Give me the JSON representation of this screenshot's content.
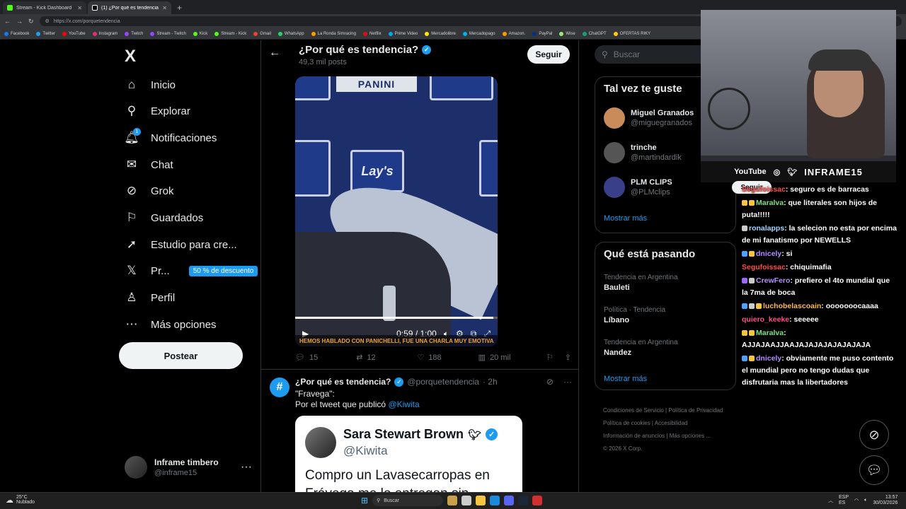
{
  "browser": {
    "tabs": [
      {
        "label": "Stream - Kick Dashboard",
        "color": "#53fc18"
      },
      {
        "label": "(1) ¿Por qué es tendencia? (@porq",
        "color": "#ffffff"
      }
    ],
    "url": "https://x.com/porquetendencia",
    "bookmarks": [
      "Facebook",
      "Twitter",
      "YouTube",
      "Instagram",
      "Twitch",
      "Stream - Twitch",
      "Kick",
      "Stream - Kick",
      "Gmail",
      "WhatsApp",
      "La Ronda Simracing",
      "Netflix",
      "Prime Video",
      "Mercadolibre",
      "Mercadopago",
      "Amazon.",
      "PayPal",
      "Wise",
      "ChatGPT",
      "OFERTAS RIKY"
    ]
  },
  "nav": {
    "logo": "X",
    "items": [
      {
        "label": "Inicio",
        "icon": "home-icon",
        "glyph": "⌂"
      },
      {
        "label": "Explorar",
        "icon": "search-icon",
        "glyph": "⚲"
      },
      {
        "label": "Notificaciones",
        "icon": "bell-icon",
        "glyph": "🔔︎",
        "badge": "1"
      },
      {
        "label": "Chat",
        "icon": "mail-icon",
        "glyph": "✉"
      },
      {
        "label": "Grok",
        "icon": "grok-icon",
        "glyph": "⊘"
      },
      {
        "label": "Guardados",
        "icon": "bookmark-icon",
        "glyph": "⚐"
      },
      {
        "label": "Estudio para cre...",
        "icon": "rocket-icon",
        "glyph": "➚"
      },
      {
        "label": "Pr...",
        "icon": "x-premium-icon",
        "glyph": "𝕏",
        "promo": "50 % de descuento"
      },
      {
        "label": "Perfil",
        "icon": "profile-icon",
        "glyph": "♙"
      },
      {
        "label": "Más opciones",
        "icon": "more-circle-icon",
        "glyph": "⋯"
      }
    ],
    "post_label": "Postear",
    "account": {
      "name": "Inframe timbero",
      "handle": "@inframe15"
    }
  },
  "profile": {
    "title": "¿Por qué es tendencia?",
    "posts": "49,3 mil posts",
    "follow_label": "Seguir"
  },
  "tweet1": {
    "video": {
      "panel_top": "PANINI",
      "panel_logo": "Lay's",
      "caption": "HEMOS HABLADO CON PANICHELLI, FUE UNA CHARLA MUY EMOTIVA",
      "time": "0:59 / 1:00",
      "progress": 0.98
    },
    "replies": "15",
    "reposts": "12",
    "likes": "188",
    "views": "20 mil"
  },
  "tweet2": {
    "avatar": "#",
    "name": "¿Por qué es tendencia?",
    "handle": "@porquetendencia",
    "time": "· 2h",
    "line1": "\"Fravega\":",
    "line2_prefix": "Por el tweet que publicó",
    "mention": "@Kiwita",
    "card": {
      "name": "Sara Stewart Brown",
      "handle": "@Kiwita",
      "text": "Compro un Lavasecarropas en Frávega me lo entregan sin..."
    }
  },
  "right": {
    "search_placeholder": "Buscar",
    "suggest_title": "Tal vez te guste",
    "suggestions": [
      {
        "name": "Miguel Granados",
        "handle": "@miguegranados",
        "color": "#c98b5a"
      },
      {
        "name": "trinche",
        "handle": "@martindardik",
        "color": "#555555"
      },
      {
        "name": "PLM CLIPS",
        "handle": "@PLMclips",
        "color": "#3a3f8a"
      }
    ],
    "follow_label": "Seguir",
    "more_label": "Mostrar más",
    "trends_title": "Qué está pasando",
    "trends": [
      {
        "category": "Tendencia en Argentina",
        "title": "Bauleti"
      },
      {
        "category": "Política · Tendencia",
        "title": "Líbano"
      },
      {
        "category": "Tendencia en Argentina",
        "title": "Nandez"
      }
    ],
    "footer": [
      "Condiciones de Servicio",
      "Política de Privacidad",
      "Política de cookies",
      "Accesibilidad",
      "Información de anuncios",
      "Más opciones ...",
      "© 2026 X Corp."
    ]
  },
  "webcam": {
    "youtube": "YouTube",
    "name": "INFRAME15"
  },
  "chat": [
    {
      "user": "Segufoissac",
      "color": "#ff4b4b",
      "text": ": seguro es de barracas"
    },
    {
      "user": "Maralva",
      "color": "#7be37b",
      "text": ": que literales son hijos de puta!!!!!"
    },
    {
      "user": "ronalapps",
      "color": "#9fd6ff",
      "text": ": la selecion no esta por encima de mi fanatismo por NEWELLS"
    },
    {
      "user": "dnicely",
      "color": "#b38cff",
      "text": ": si"
    },
    {
      "user": "Segufoissac",
      "color": "#ff4b4b",
      "text": ": chiquimafia"
    },
    {
      "user": "CrewFero",
      "color": "#b38cff",
      "text": ": prefiero el 4to mundial que la 7ma de boca"
    },
    {
      "user": "luchobelascoain",
      "color": "#ffb84d",
      "text": ": ooooooocaaaa"
    },
    {
      "user": "quiero_keeke",
      "color": "#ff4b8b",
      "text": ": seeeee"
    },
    {
      "user": "Maralva",
      "color": "#7be37b",
      "text": ": AJJAJAAJJAAJAJAJAJAJAJAJAJA"
    },
    {
      "user": "dnicely",
      "color": "#b38cff",
      "text": ": obviamente me puso contento el mundial pero no tengo dudas que disfrutaria mas la libertadores"
    }
  ],
  "taskbar": {
    "temp": "25°C",
    "weather": "Nublado",
    "search": "Buscar",
    "lang1": "ESP",
    "lang2": "ES",
    "time": "13:57",
    "date": "30/03/2026"
  }
}
